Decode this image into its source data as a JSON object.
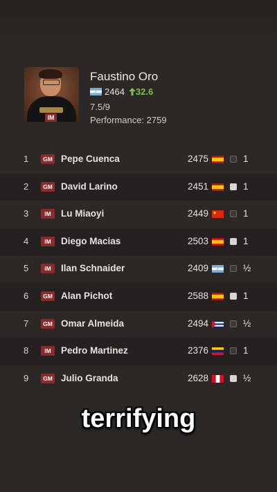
{
  "player": {
    "name": "Faustino Oro",
    "title": "IM",
    "rating": "2464",
    "rating_change": "32.6",
    "score": "7.5/9",
    "performance": "Performance: 2759",
    "flag": "argentina-flag-icon"
  },
  "opponents": [
    {
      "num": "1",
      "title": "GM",
      "name": "Pepe Cuenca",
      "rating": "2475",
      "flag": "spain",
      "color": "black",
      "result": "1"
    },
    {
      "num": "2",
      "title": "GM",
      "name": "David Larino",
      "rating": "2451",
      "flag": "spain",
      "color": "white",
      "result": "1"
    },
    {
      "num": "3",
      "title": "IM",
      "name": "Lu Miaoyi",
      "rating": "2449",
      "flag": "china",
      "color": "black",
      "result": "1"
    },
    {
      "num": "4",
      "title": "IM",
      "name": "Diego Macias",
      "rating": "2503",
      "flag": "spain",
      "color": "white",
      "result": "1"
    },
    {
      "num": "5",
      "title": "IM",
      "name": "Ilan Schnaider",
      "rating": "2409",
      "flag": "argentina",
      "color": "black",
      "result": "½"
    },
    {
      "num": "6",
      "title": "GM",
      "name": "Alan Pichot",
      "rating": "2588",
      "flag": "spain",
      "color": "white",
      "result": "1"
    },
    {
      "num": "7",
      "title": "GM",
      "name": "Omar Almeida",
      "rating": "2494",
      "flag": "cuba",
      "color": "black",
      "result": "½"
    },
    {
      "num": "8",
      "title": "IM",
      "name": "Pedro Martinez",
      "rating": "2376",
      "flag": "venezuela",
      "color": "black",
      "result": "1"
    },
    {
      "num": "9",
      "title": "GM",
      "name": "Julio Granda",
      "rating": "2628",
      "flag": "peru",
      "color": "white",
      "result": "½"
    }
  ],
  "caption": "terrifying",
  "colors": {
    "gain": "#7fbf47",
    "title_tag": "#8e2a2c",
    "background": "#2b2826"
  }
}
